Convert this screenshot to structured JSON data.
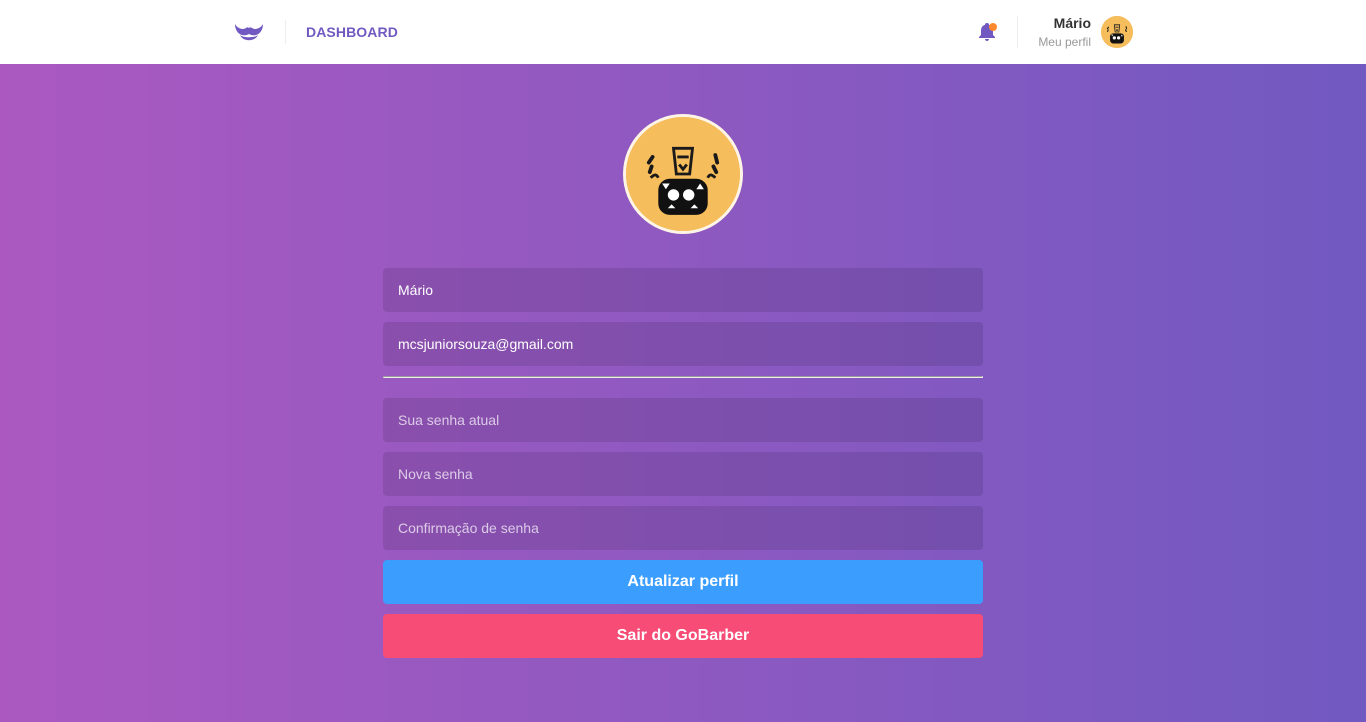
{
  "header": {
    "nav_link": "DASHBOARD",
    "profile_name": "Mário",
    "profile_link": "Meu perfil",
    "notification_dot_color": "#ff892e",
    "brand_color": "#7159c1"
  },
  "form": {
    "name_value": "Mário",
    "email_value": "mcsjuniorsouza@gmail.com",
    "old_password_placeholder": "Sua senha atual",
    "new_password_placeholder": "Nova senha",
    "confirm_password_placeholder": "Confirmação de senha",
    "submit_label": "Atualizar perfil",
    "logout_label": "Sair do GoBarber"
  },
  "icons": {
    "logo": "mustache-logo-icon",
    "notifications": "bell-icon",
    "avatar": "monster-face-avatar"
  }
}
